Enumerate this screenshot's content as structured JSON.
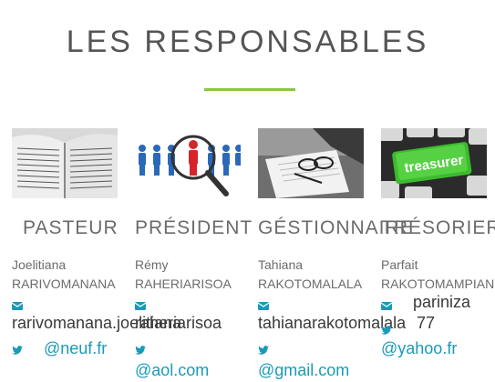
{
  "section": {
    "title": "LES RESPONSABLES"
  },
  "members": [
    {
      "role": "PASTEUR",
      "first_name": "Joelitiana",
      "last_name": "RARIVOMANANA",
      "email": "rarivomanana.joelitiana",
      "twitter": "@neuf.fr",
      "image": "open-book-photo"
    },
    {
      "role": "PRÉSIDENT",
      "first_name": "Rémy",
      "last_name": "RAHERIARISOA",
      "email": "raheriarisoa",
      "twitter": "@aol.com",
      "image": "magnifying-glass-people-photo"
    },
    {
      "role": "GÉSTIONNAIRE",
      "first_name": "Tahiana",
      "last_name": "RAKOTOMALALA",
      "email": "tahianarakotomalala",
      "twitter": "@gmail.com",
      "image": "documents-glasses-laptop-photo"
    },
    {
      "role": "TRÉSORIER",
      "first_name": "Parfait",
      "last_name": "RAKOTOMAMPIANINA",
      "email": "pariniza 77",
      "email_line1": "pariniza",
      "email_line2": "77",
      "twitter": "@yahoo.fr",
      "image": "treasurer-keyboard-photo"
    }
  ],
  "colors": {
    "accent": "#8cc540",
    "icon": "#1a9ab8",
    "text": "#6b6b6b"
  }
}
